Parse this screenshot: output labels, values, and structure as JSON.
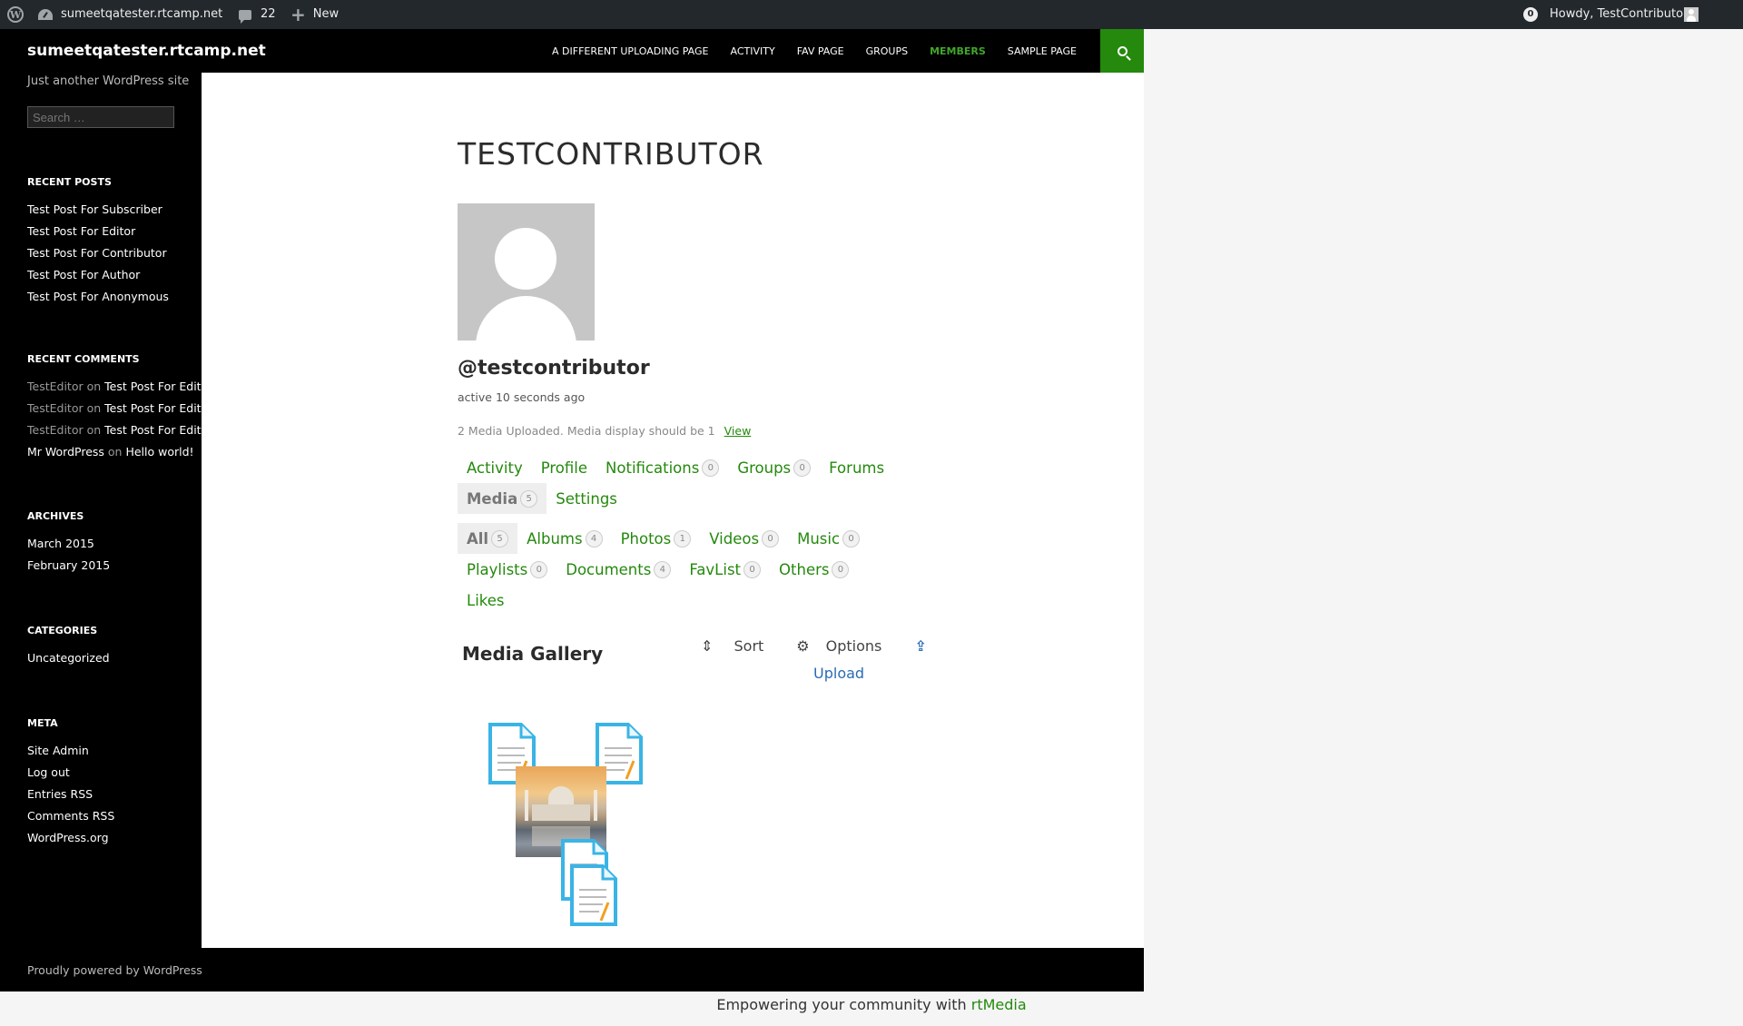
{
  "admin_bar": {
    "site_name": "sumeetqatester.rtcamp.net",
    "comments_count": "22",
    "new_label": "New",
    "notifications_count": "0",
    "howdy": "Howdy, TestContributor"
  },
  "header": {
    "site_title": "sumeetqatester.rtcamp.net",
    "nav": [
      "A DIFFERENT UPLOADING PAGE",
      "ACTIVITY",
      "FAV PAGE",
      "GROUPS",
      "MEMBERS",
      "SAMPLE PAGE"
    ]
  },
  "sidebar": {
    "tagline": "Just another WordPress site",
    "search_placeholder": "Search …",
    "recent_posts_title": "RECENT POSTS",
    "recent_posts": [
      "Test Post For Subscriber",
      "Test Post For Editor",
      "Test Post For Contributor",
      "Test Post For Author",
      "Test Post For Anonymous"
    ],
    "recent_comments_title": "RECENT COMMENTS",
    "recent_comments": [
      {
        "author": "TestEditor",
        "sep": " on ",
        "post": "Test Post For Editor"
      },
      {
        "author": "TestEditor",
        "sep": " on ",
        "post": "Test Post For Editor"
      },
      {
        "author": "TestEditor",
        "sep": " on ",
        "post": "Test Post For Editor"
      },
      {
        "author": "Mr WordPress",
        "sep": " on ",
        "post": "Hello world!"
      }
    ],
    "archives_title": "ARCHIVES",
    "archives": [
      "March 2015",
      "February 2015"
    ],
    "categories_title": "CATEGORIES",
    "categories": [
      "Uncategorized"
    ],
    "meta_title": "META",
    "meta": [
      "Site Admin",
      "Log out",
      "Entries RSS",
      "Comments RSS",
      "WordPress.org"
    ]
  },
  "main": {
    "title": "TESTCONTRIBUTOR",
    "username": "@testcontributor",
    "activity": "active 10 seconds ago",
    "media_note": "2 Media Uploaded. Media display should be 1",
    "media_note_link": "View",
    "profile_tabs": [
      {
        "label": "Activity",
        "count": null
      },
      {
        "label": "Profile",
        "count": null
      },
      {
        "label": "Notifications",
        "count": "0"
      },
      {
        "label": "Groups",
        "count": "0"
      },
      {
        "label": "Forums",
        "count": null
      }
    ],
    "profile_tabs_row2": [
      {
        "label": "Media",
        "count": "5",
        "active": true
      },
      {
        "label": "Settings",
        "count": null
      }
    ],
    "media_tabs": [
      {
        "label": "All",
        "count": "5",
        "active": true
      },
      {
        "label": "Albums",
        "count": "4"
      },
      {
        "label": "Photos",
        "count": "1"
      },
      {
        "label": "Videos",
        "count": "0"
      },
      {
        "label": "Music",
        "count": "0"
      }
    ],
    "media_tabs_row2": [
      {
        "label": "Playlists",
        "count": "0"
      },
      {
        "label": "Documents",
        "count": "4"
      },
      {
        "label": "FavList",
        "count": "0"
      },
      {
        "label": "Others",
        "count": "0"
      }
    ],
    "media_tabs_row3": [
      {
        "label": "Likes",
        "count": null
      }
    ],
    "gallery_title": "Media Gallery",
    "sort_label": "Sort",
    "options_label": "Options",
    "upload_label": "Upload"
  },
  "footer": {
    "powered": "Proudly powered by WordPress",
    "credit_prefix": "Empowering your community with ",
    "credit_link": "rtMedia"
  },
  "colors": {
    "accent": "#24890d",
    "nav_active": "#41a62a",
    "link_blue": "#2a6bb5"
  }
}
